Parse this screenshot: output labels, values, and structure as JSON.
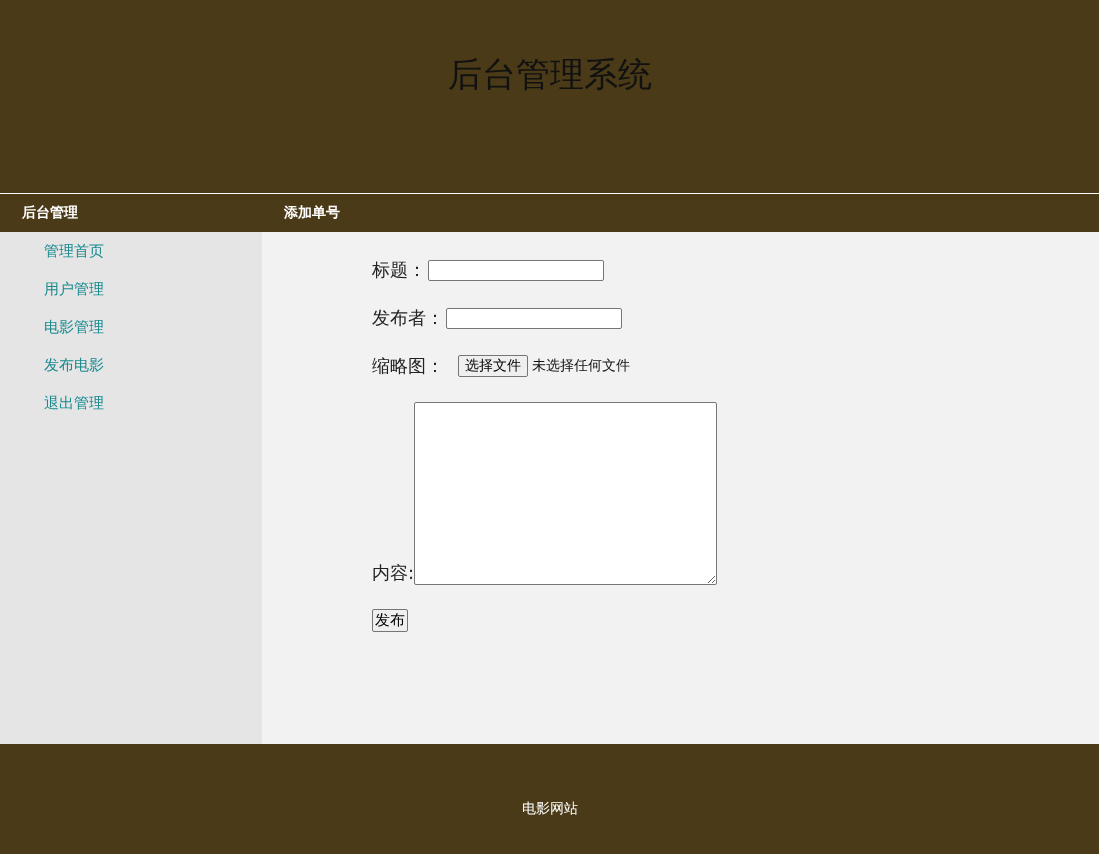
{
  "header": {
    "title": "后台管理系统"
  },
  "nav": {
    "sidebar_title": "后台管理",
    "page_title": "添加单号"
  },
  "sidebar": {
    "items": [
      {
        "label": "管理首页"
      },
      {
        "label": "用户管理"
      },
      {
        "label": "电影管理"
      },
      {
        "label": "发布电影"
      },
      {
        "label": "退出管理"
      }
    ]
  },
  "form": {
    "fields": [
      {
        "kind": "text",
        "label": "标题："
      },
      {
        "kind": "text",
        "label": "发布者："
      },
      {
        "kind": "file",
        "label": "缩略图：",
        "button": "选择文件",
        "status": "未选择任何文件"
      },
      {
        "kind": "textarea",
        "label": "内容:"
      }
    ],
    "submit": "发布"
  },
  "footer": {
    "text": "电影网站"
  }
}
